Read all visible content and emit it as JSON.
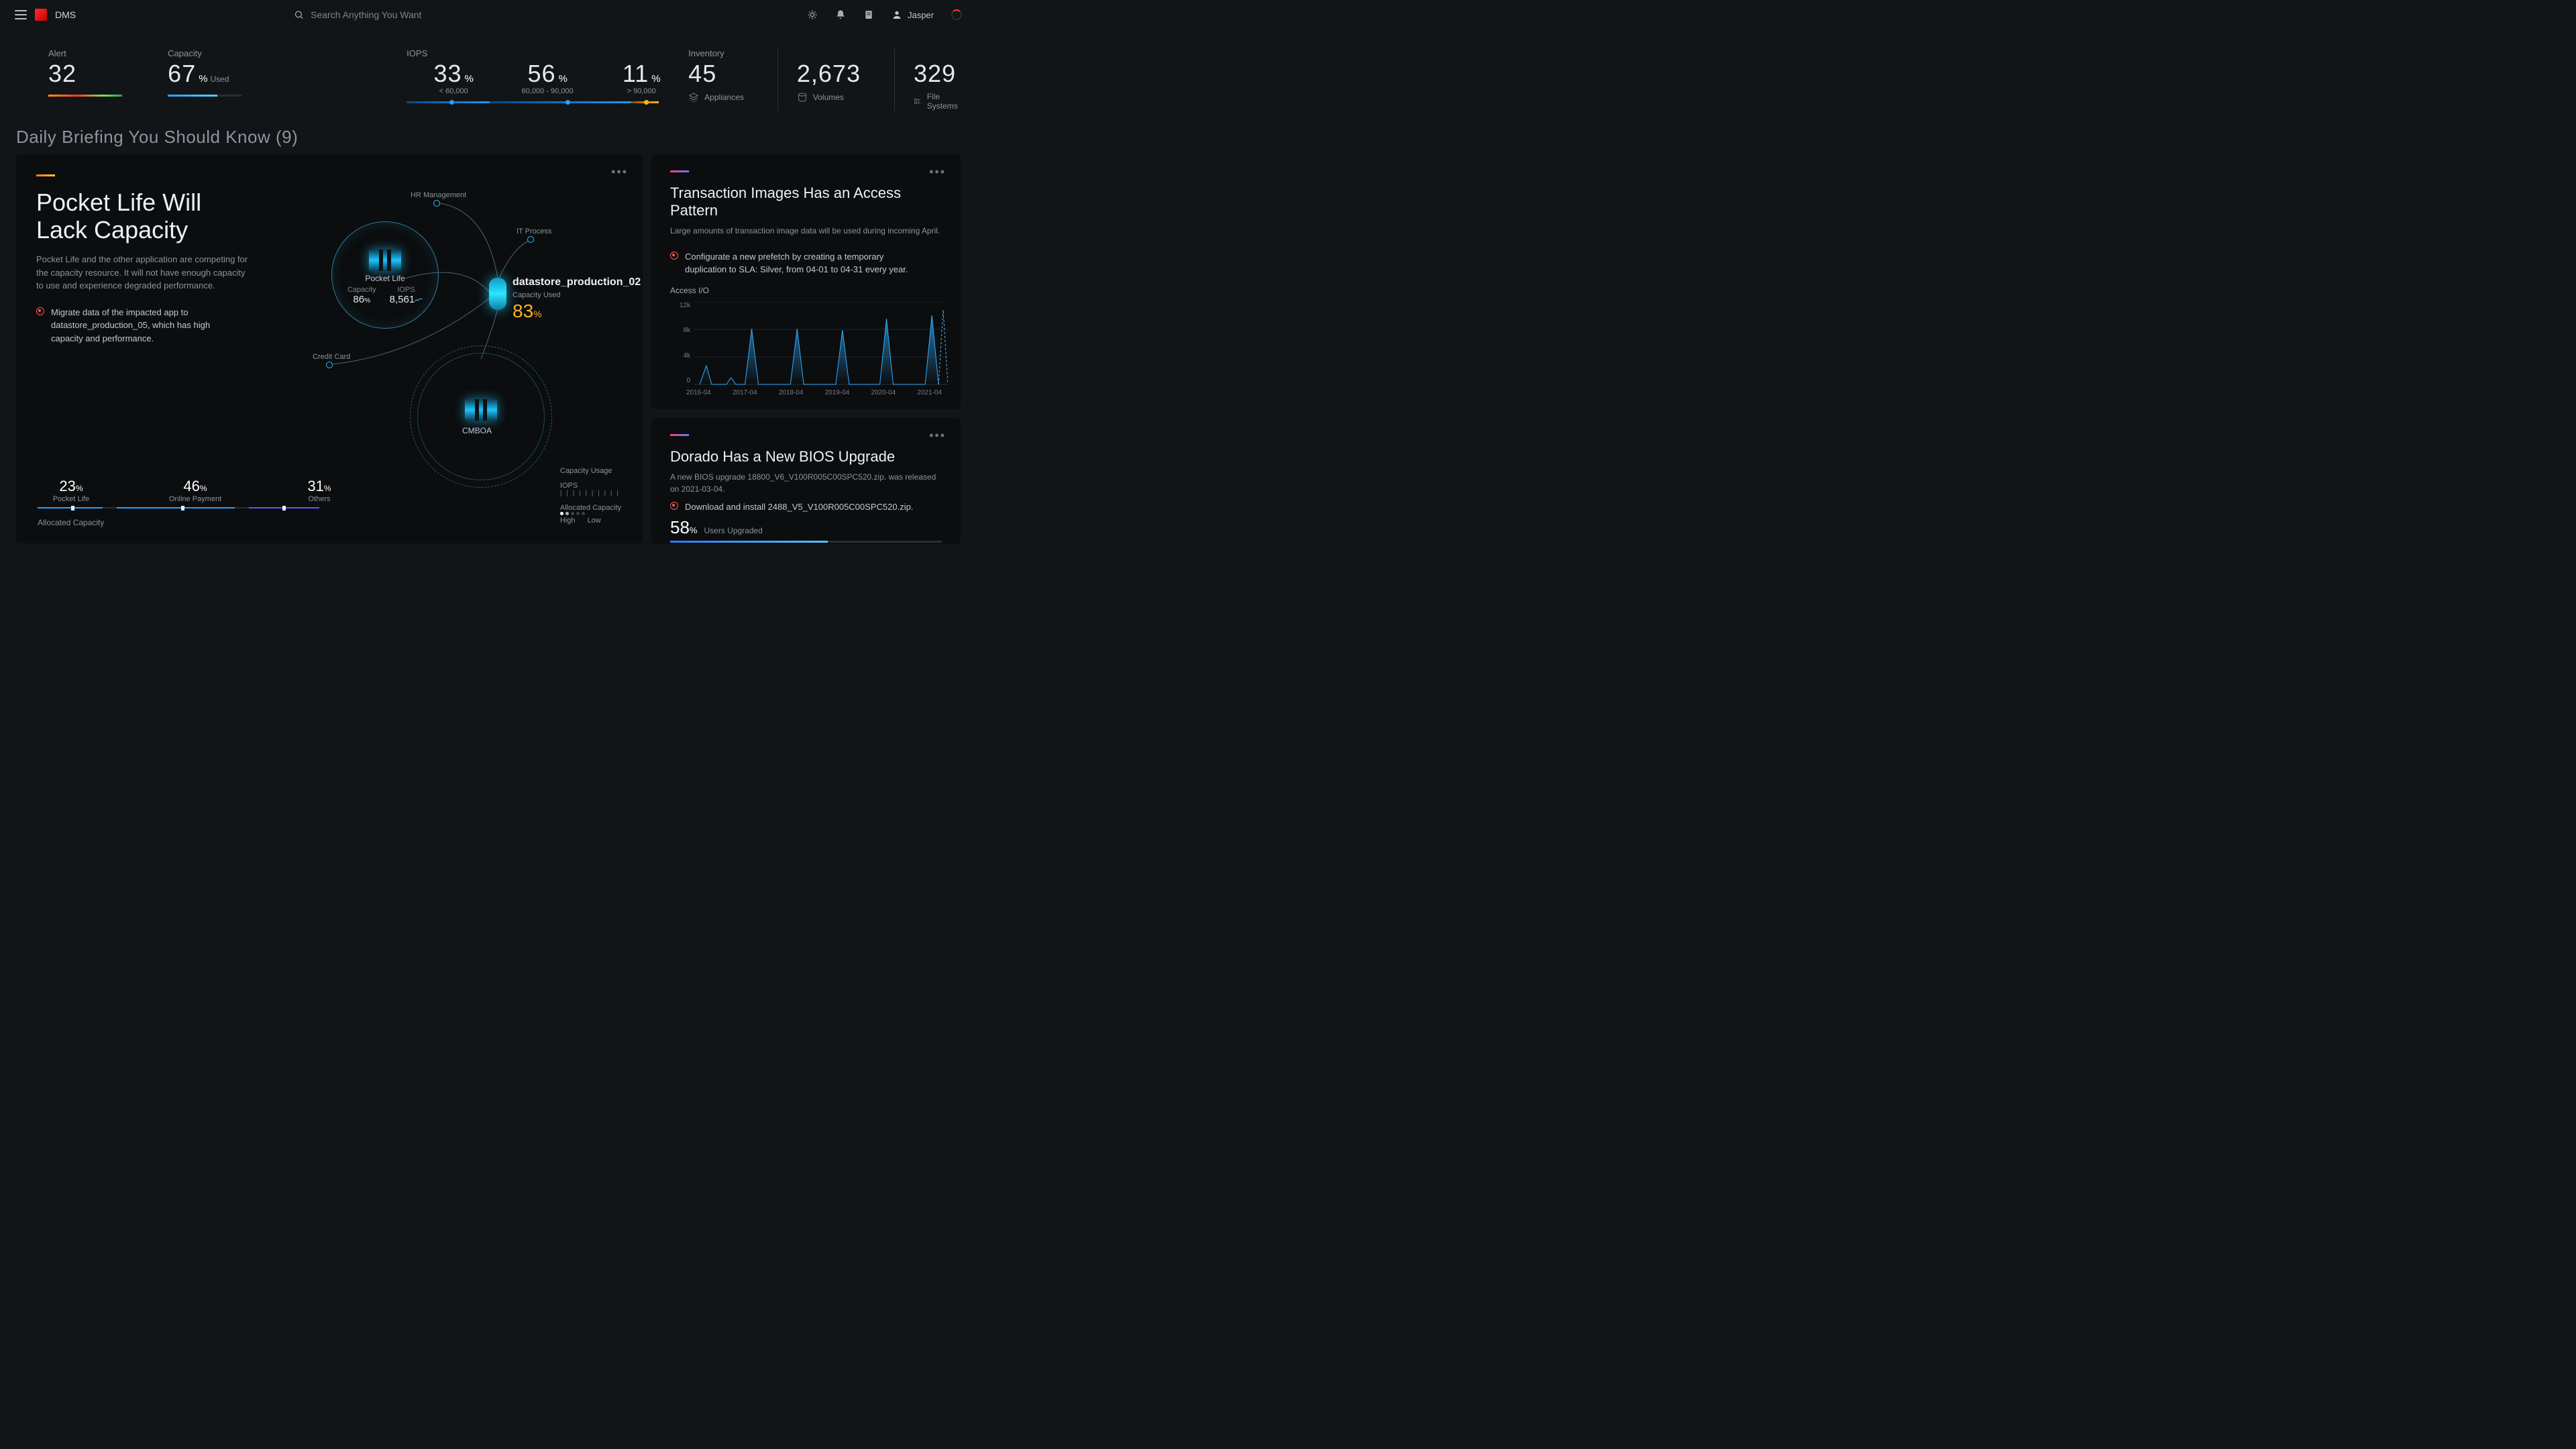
{
  "header": {
    "brand": "DMS",
    "search_placeholder": "Search Anything You Want",
    "user": "Jasper"
  },
  "stats": {
    "alert": {
      "label": "Alert",
      "value": "32"
    },
    "capacity": {
      "label": "Capacity",
      "value": "67",
      "pct": "%",
      "unit": "Used"
    },
    "iops": {
      "label": "IOPS",
      "cols": [
        {
          "v": "33",
          "sub": "< 60,000"
        },
        {
          "v": "56",
          "sub": "60,000 - 90,000"
        },
        {
          "v": "11",
          "sub": "> 90,000"
        }
      ]
    },
    "inventory": {
      "label": "Inventory",
      "cols": [
        {
          "v": "45",
          "label": "Appliances"
        },
        {
          "v": "2,673",
          "label": "Volumes"
        },
        {
          "v": "329",
          "label": "File Systems"
        }
      ]
    }
  },
  "briefing_title": "Daily Briefing You Should Know (9)",
  "cardL": {
    "title": "Pocket Life Will Lack Capacity",
    "desc": "Pocket Life and the other application are competing for the capacity resource. It will not have enough capacity to use and experience degraded performance.",
    "action": "Migrate data of the impacted app to datastore_production_05, which has high capacity and performance.",
    "diagram": {
      "hr": "HR Management",
      "it": "IT Process",
      "credit": "Credit Card",
      "pl": {
        "name": "Pocket Life",
        "cap_lbl": "Capacity",
        "cap": "86",
        "iops_lbl": "IOPS",
        "iops": "8,561"
      },
      "cm": "CMBOA",
      "ds": {
        "name": "datastore_production_02",
        "sub": "Capacity Used",
        "val": "83"
      }
    },
    "alloc": {
      "cols": [
        {
          "v": "23",
          "label": "Pocket Life"
        },
        {
          "v": "46",
          "label": "Online Payment"
        },
        {
          "v": "31",
          "label": "Others"
        }
      ],
      "title": "Allocated Capacity"
    },
    "legend": {
      "cu": "Capacity Usage",
      "iops": "IOPS",
      "ac": "Allocated Capacity",
      "hi": "High",
      "lo": "Low"
    }
  },
  "cardR1": {
    "title": "Transaction Images Has an Access Pattern",
    "desc": "Large amounts of transaction image data will be used during incoming April.",
    "action": "Configurate a new prefetch by creating a temporary duplication to SLA: Silver, from 04-01 to 04-31 every year.",
    "chart_title": "Access I/O"
  },
  "chart_data": {
    "type": "area",
    "title": "Access I/O",
    "xlabel": "",
    "ylabel": "",
    "ylim": [
      0,
      12000
    ],
    "y_ticks": [
      "12k",
      "8k",
      "4k",
      "0"
    ],
    "categories": [
      "2016-04",
      "2017-04",
      "2018-04",
      "2019-04",
      "2020-04",
      "2021-04"
    ],
    "values": [
      3000,
      8500,
      8500,
      8200,
      9800,
      10200
    ],
    "forecast_value": 11000
  },
  "cardR2": {
    "title": "Dorado Has a New BIOS Upgrade",
    "desc": "A new BIOS upgrade 18800_V6_V100R005C00SPC520.zip. was released on 2021-03-04.",
    "action": "Download and install 2488_V5_V100R005C00SPC520.zip.",
    "prog_v": "58",
    "prog_lbl": "Users Upgraded"
  }
}
